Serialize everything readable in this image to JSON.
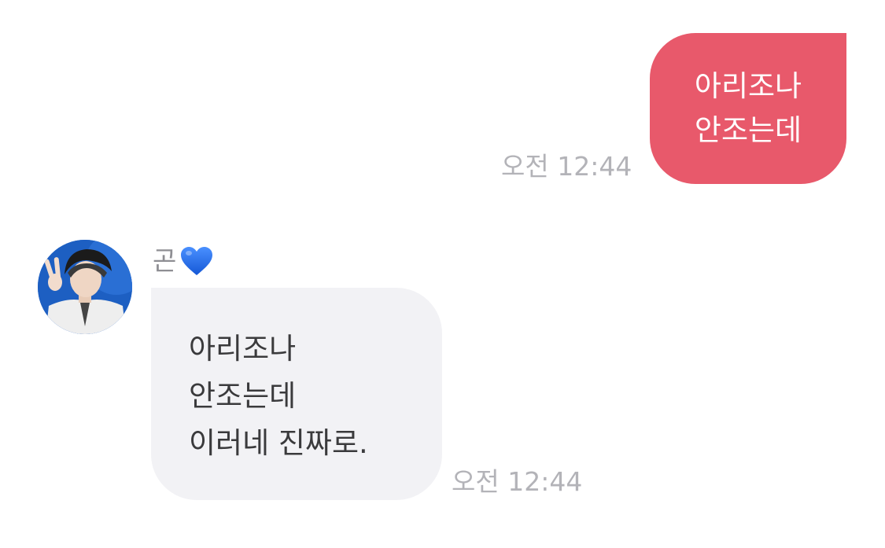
{
  "colors": {
    "outgoing_bubble": "#e8596b",
    "incoming_bubble": "#f2f2f5",
    "timestamp": "#b3b3b8",
    "sender_name": "#8e8e93",
    "heart": "#1f6ff0"
  },
  "messages": {
    "outgoing": {
      "lines": [
        "아리조나",
        "안조는데"
      ],
      "time": "오전 12:44"
    },
    "incoming": {
      "sender": {
        "name": "곤",
        "emoji_icon": "blue-heart-icon"
      },
      "lines": [
        "아리조나",
        "안조는데",
        "이러네 진짜로."
      ],
      "time": "오전 12:44"
    }
  }
}
